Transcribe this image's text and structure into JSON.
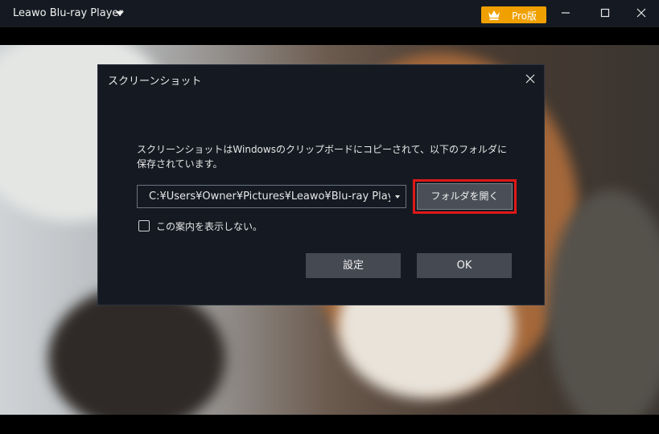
{
  "app": {
    "title": "Leawo Blu-ray Player",
    "pro_badge": "Pro版",
    "pro_color": "#f0a000"
  },
  "window_controls": {
    "minimize_icon": "minimize-icon",
    "maximize_icon": "maximize-icon",
    "close_icon": "close-icon"
  },
  "dialog": {
    "title": "スクリーンショット",
    "message": "スクリーンショットはWindowsのクリップボードにコピーされて、以下のフォルダに保存されています。",
    "path_value": "C:¥Users¥Owner¥Pictures¥Leawo¥Blu-ray Player",
    "open_folder_label": "フォルダを開く",
    "checkbox_label": "この案内を表示しない。",
    "checkbox_checked": false,
    "settings_label": "設定",
    "ok_label": "OK",
    "highlight_color": "#e01818"
  }
}
